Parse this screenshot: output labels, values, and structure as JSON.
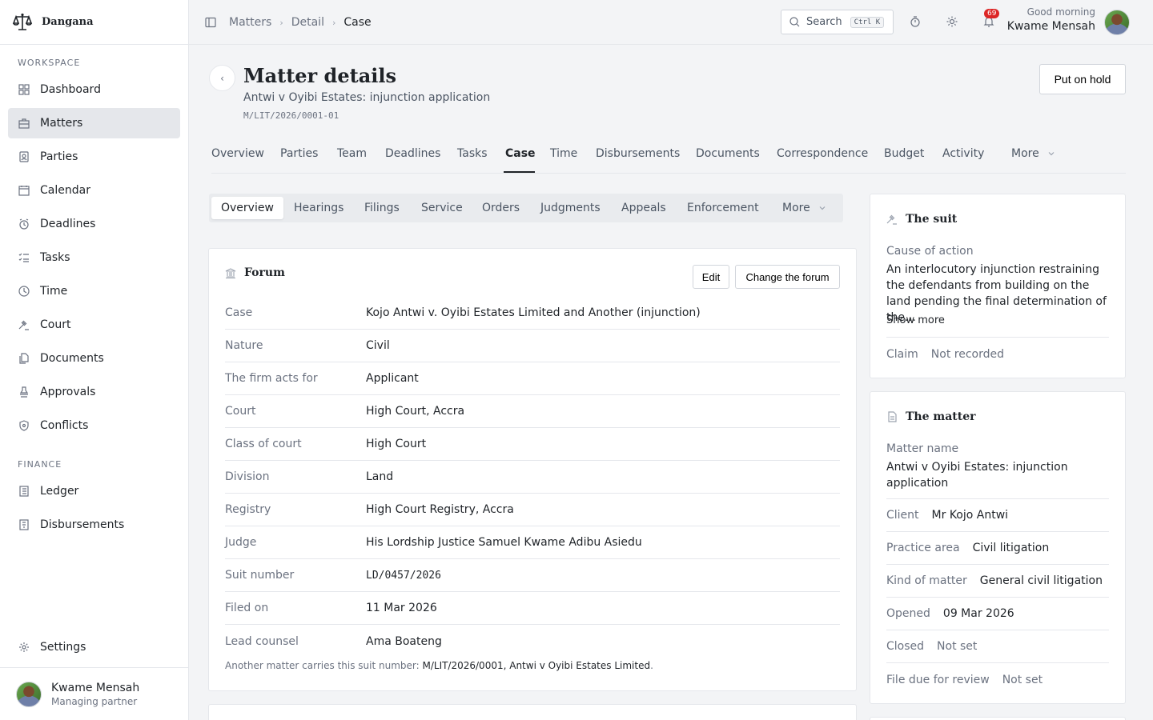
{
  "app": {
    "name": "Dangana"
  },
  "sidebar": {
    "workspace_label": "WORKSPACE",
    "finance_label": "FINANCE",
    "items": [
      {
        "label": "Dashboard",
        "icon": "grid-icon"
      },
      {
        "label": "Matters",
        "icon": "briefcase-icon",
        "active": true
      },
      {
        "label": "Parties",
        "icon": "contact-icon"
      },
      {
        "label": "Calendar",
        "icon": "calendar-icon"
      },
      {
        "label": "Deadlines",
        "icon": "alarm-icon"
      },
      {
        "label": "Tasks",
        "icon": "checklist-icon"
      },
      {
        "label": "Time",
        "icon": "clock-icon"
      },
      {
        "label": "Court",
        "icon": "gavel-icon"
      },
      {
        "label": "Documents",
        "icon": "documents-icon"
      },
      {
        "label": "Approvals",
        "icon": "stamp-icon"
      },
      {
        "label": "Conflicts",
        "icon": "shield-icon"
      }
    ],
    "finance_items": [
      {
        "label": "Ledger",
        "icon": "ledger-icon"
      },
      {
        "label": "Disbursements",
        "icon": "receipt-icon"
      }
    ],
    "settings_label": "Settings",
    "user": {
      "name": "Kwame Mensah",
      "role": "Managing partner"
    }
  },
  "topbar": {
    "breadcrumbs": [
      "Matters",
      "Detail",
      "Case"
    ],
    "search_label": "Search",
    "search_shortcut": "Ctrl K",
    "notification_count": "69",
    "greeting": "Good morning",
    "user_name": "Kwame Mensah"
  },
  "header": {
    "title": "Matter details",
    "subtitle": "Antwi v Oyibi Estates: injunction application",
    "reference": "M/LIT/2026/0001-01",
    "hold_button": "Put on hold"
  },
  "tabs": {
    "items": [
      "Overview",
      "Parties",
      "Team",
      "Deadlines",
      "Tasks",
      "Case",
      "Time",
      "Disbursements",
      "Documents",
      "Correspondence",
      "Budget",
      "Activity",
      "More"
    ],
    "active": "Case"
  },
  "subtabs": {
    "items": [
      "Overview",
      "Hearings",
      "Filings",
      "Service",
      "Orders",
      "Judgments",
      "Appeals",
      "Enforcement",
      "More"
    ],
    "active": "Overview"
  },
  "forum": {
    "title": "Forum",
    "edit_button": "Edit",
    "change_button": "Change the forum",
    "rows": [
      {
        "label": "Case",
        "value": "Kojo Antwi v. Oyibi Estates Limited and Another (injunction)"
      },
      {
        "label": "Nature",
        "value": "Civil"
      },
      {
        "label": "The firm acts for",
        "value": "Applicant"
      },
      {
        "label": "Court",
        "value": "High Court, Accra"
      },
      {
        "label": "Class of court",
        "value": "High Court"
      },
      {
        "label": "Division",
        "value": "Land"
      },
      {
        "label": "Registry",
        "value": "High Court Registry, Accra"
      },
      {
        "label": "Judge",
        "value": "His Lordship Justice Samuel Kwame Adibu Asiedu"
      },
      {
        "label": "Suit number",
        "value": "LD/0457/2026"
      },
      {
        "label": "Filed on",
        "value": "11 Mar 2026"
      },
      {
        "label": "Lead counsel",
        "value": "Ama Boateng"
      }
    ],
    "note_prefix": "Another matter carries this suit number: ",
    "note_link": "M/LIT/2026/0001, Antwi v Oyibi Estates Limited",
    "note_suffix": "."
  },
  "suit": {
    "title": "The suit",
    "cause_label": "Cause of action",
    "cause_text": "An interlocutory injunction restraining the defendants from building on the land pending the final determination of the…",
    "show_more": "Show more",
    "claim_label": "Claim",
    "claim_value": "Not recorded"
  },
  "matter": {
    "title": "The matter",
    "name_label": "Matter name",
    "name_value": "Antwi v Oyibi Estates: injunction application",
    "rows": [
      {
        "label": "Client",
        "value": "Mr Kojo Antwi",
        "muted": false
      },
      {
        "label": "Practice area",
        "value": "Civil litigation",
        "muted": false
      },
      {
        "label": "Kind of matter",
        "value": "General civil litigation",
        "muted": false
      },
      {
        "label": "Opened",
        "value": "09 Mar 2026",
        "muted": false
      },
      {
        "label": "Closed",
        "value": "Not set",
        "muted": true
      },
      {
        "label": "File due for review",
        "value": "Not set",
        "muted": true
      }
    ]
  }
}
